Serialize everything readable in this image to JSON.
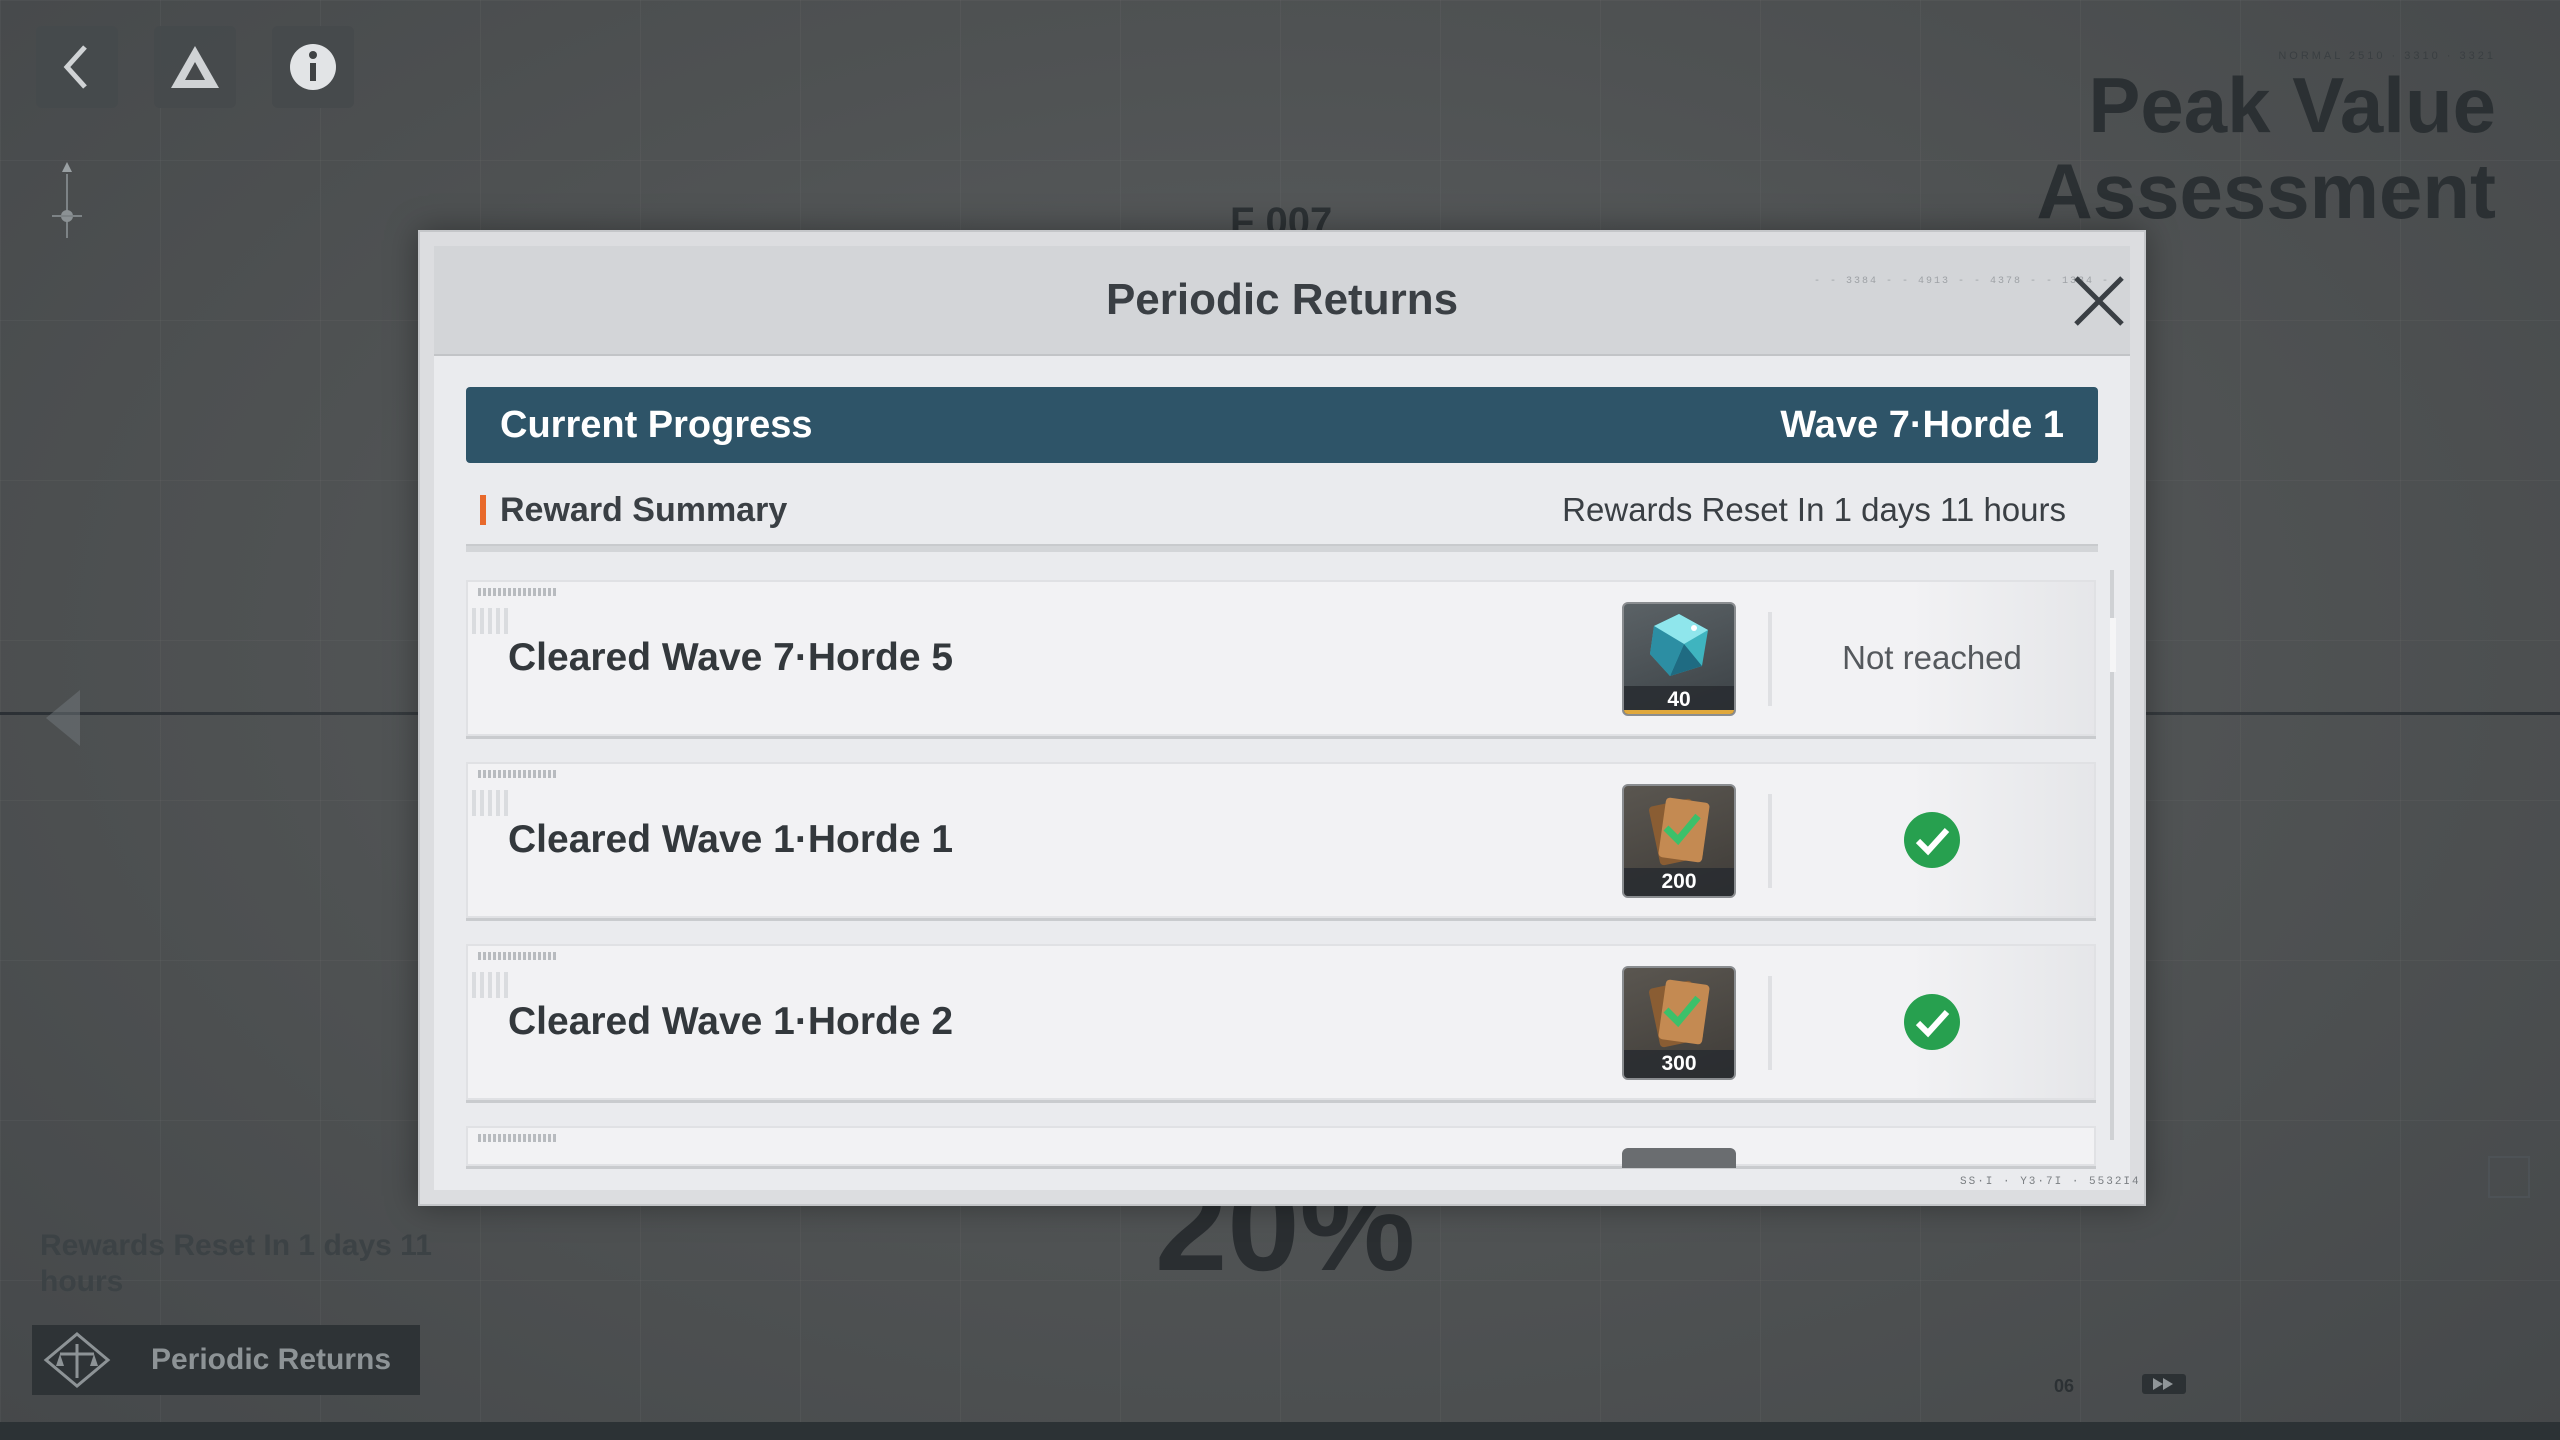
{
  "hud": {
    "back_icon": "chevron-left-icon",
    "logo_icon": "triangle-logo-icon",
    "info_icon": "info-icon",
    "page_title": "Peak Value Assessment",
    "bg_code": "F 007",
    "bg_percent": "20%",
    "bg_reset_text": "Rewards Reset In 1 days 11 hours",
    "periodic_button_label": "Periodic Returns",
    "page_number": "06"
  },
  "modal": {
    "title": "Periodic Returns",
    "close_icon": "close-icon",
    "progress": {
      "label": "Current Progress",
      "value": "Wave 7·Horde 1"
    },
    "summary": {
      "title": "Reward Summary",
      "reset_text": "Rewards Reset In 1 days 11 hours"
    },
    "rewards": [
      {
        "label": "Cleared Wave 7·Horde 5",
        "item_icon": "crystal-icon",
        "count": "40",
        "status_text": "Not reached",
        "claimed": false
      },
      {
        "label": "Cleared Wave 1·Horde 1",
        "item_icon": "voucher-card-icon",
        "count": "200",
        "status_text": "",
        "claimed": true
      },
      {
        "label": "Cleared Wave 1·Horde 2",
        "item_icon": "voucher-card-icon",
        "count": "300",
        "status_text": "",
        "claimed": true
      }
    ]
  },
  "colors": {
    "progress_bar": "#2e5468",
    "accent": "#e8692b",
    "claimed_check": "#27a04f"
  }
}
